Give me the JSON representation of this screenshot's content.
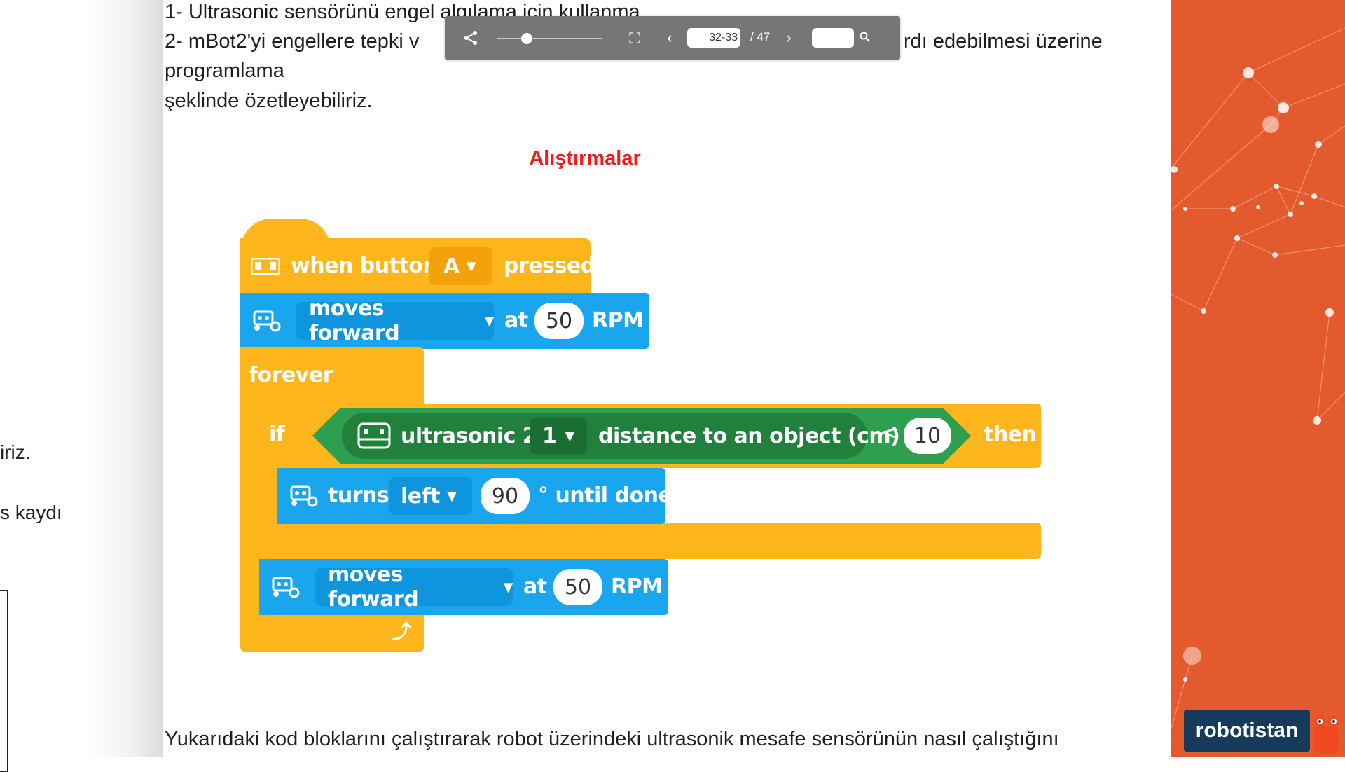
{
  "left_page": {
    "frag1": "iriz.",
    "frag2": "s kaydı"
  },
  "text": {
    "line1": "1- Ultrasonic sensörünü engel algılama için kullanma",
    "line2_start": "2- mBot2'yi engellere tepki v",
    "line2_end": "rdı edebilmesi üzerine",
    "line3": "programlama",
    "line4": "şeklinde özetleyebiliriz.",
    "heading": "Alıştırmalar",
    "bottom": "Yukarıdaki kod bloklarını çalıştırarak robot üzerindeki ultrasonik mesafe sensörünün nasıl çalıştığını"
  },
  "toolbar": {
    "page_value": "32-33",
    "total": "/ 47",
    "search_value": "",
    "icons": [
      "share-icon",
      "fullscreen-icon",
      "chevron-left-icon",
      "chevron-right-icon",
      "search-icon"
    ]
  },
  "code": {
    "hat": {
      "label": "when button",
      "dropdown": "A",
      "suffix": "pressed"
    },
    "move1": {
      "dropdown": "moves forward",
      "at": "at",
      "value": "50",
      "unit": "RPM"
    },
    "forever": "forever",
    "if": {
      "label": "if",
      "sensor": "ultrasonic 2",
      "port": "1",
      "desc": "distance to an object (cm)",
      "op": "<",
      "value": "10",
      "then": "then"
    },
    "turn": {
      "label": "turns",
      "dropdown": "left",
      "value": "90",
      "suffix": "° until done"
    },
    "move2": {
      "dropdown": "moves forward",
      "at": "at",
      "value": "50",
      "unit": "RPM"
    }
  },
  "brand": {
    "logo": "robotistan"
  },
  "colors": {
    "events_yellow": "#ffb51c",
    "motion_blue": "#1aa6ef",
    "sensor_green": "#2e9e4f",
    "heading_red": "#ee1c1c",
    "panel_orange": "#e45a2f",
    "logo_navy": "#153a5a"
  }
}
